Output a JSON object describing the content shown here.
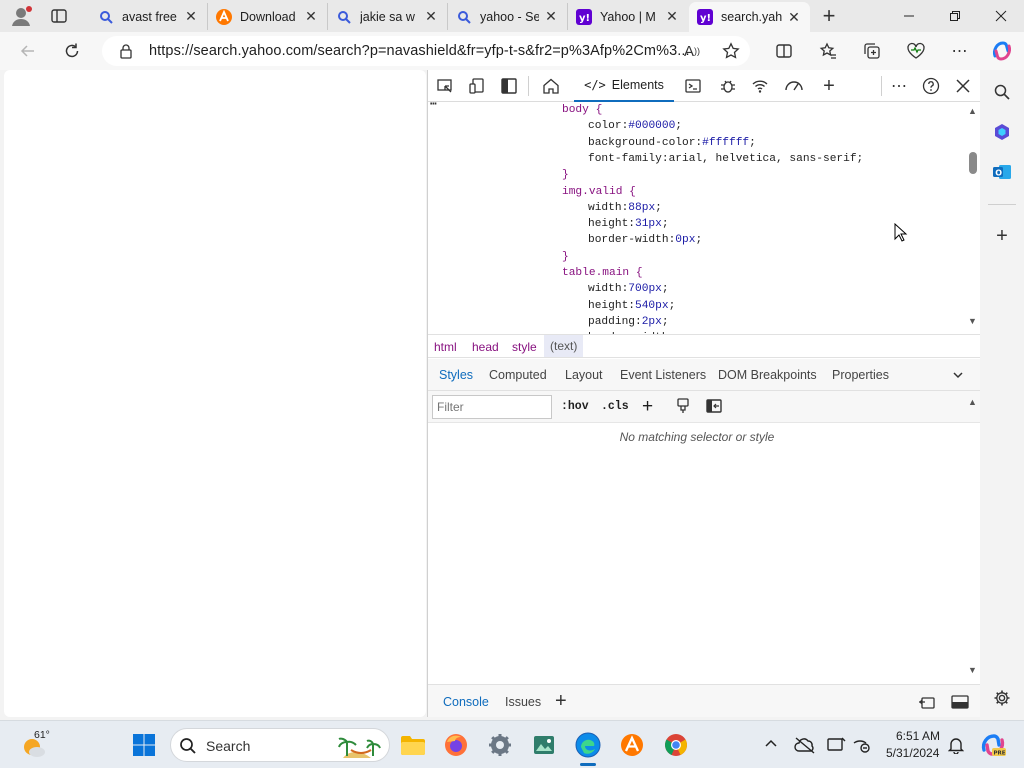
{
  "tabs": [
    {
      "title": "avast free",
      "favicon": "search-icon"
    },
    {
      "title": "Download",
      "favicon": "avast-icon"
    },
    {
      "title": "jakie sa w",
      "favicon": "search-icon"
    },
    {
      "title": "yahoo - Se",
      "favicon": "search-icon"
    },
    {
      "title": "Yahoo | M",
      "favicon": "yahoo-icon"
    },
    {
      "title": "search.yah",
      "favicon": "yahoo-icon",
      "active": true
    }
  ],
  "address_bar": {
    "url": "https://search.yahoo.com/search?p=navashield&fr=yfp-t-s&fr2=p%3Afp%2Cm%3..."
  },
  "devtools": {
    "main_tab": "Elements",
    "css_lines": [
      {
        "selector": "body {"
      },
      {
        "prop": "color:",
        "val": "#000000",
        "end": ";"
      },
      {
        "prop": "background-color:",
        "val": "#ffffff",
        "end": ";"
      },
      {
        "prop": "font-family:arial, helvetica, sans-serif;",
        "val": "",
        "end": ""
      },
      {
        "selector": "}"
      },
      {
        "selector": "img.valid {"
      },
      {
        "prop": "width:",
        "val": "88px",
        "end": ";"
      },
      {
        "prop": "height:",
        "val": "31px",
        "end": ";"
      },
      {
        "prop": "border-width:",
        "val": "0px",
        "end": ";"
      },
      {
        "selector": "}"
      },
      {
        "selector": "table.main {"
      },
      {
        "prop": "width:",
        "val": "700px",
        "end": ";"
      },
      {
        "prop": "height:",
        "val": "540px",
        "end": ";"
      },
      {
        "prop": "padding:",
        "val": "2px",
        "end": ";"
      }
    ],
    "breadcrumbs": [
      "html",
      "head",
      "style",
      "(text)"
    ],
    "sub_tabs": [
      "Styles",
      "Computed",
      "Layout",
      "Event Listeners",
      "DOM Breakpoints",
      "Properties"
    ],
    "filter_placeholder": "Filter",
    "hov_label": ":hov",
    "cls_label": ".cls",
    "no_match_text": "No matching selector or style",
    "drawer_tabs": [
      "Console",
      "Issues"
    ]
  },
  "taskbar": {
    "weather_temp": "61°",
    "search_placeholder": "Search",
    "time": "6:51 AM",
    "date": "5/31/2024"
  },
  "colors": {
    "accent": "#0f6cbd",
    "selector": "#881280",
    "value": "#1a1aa6"
  }
}
